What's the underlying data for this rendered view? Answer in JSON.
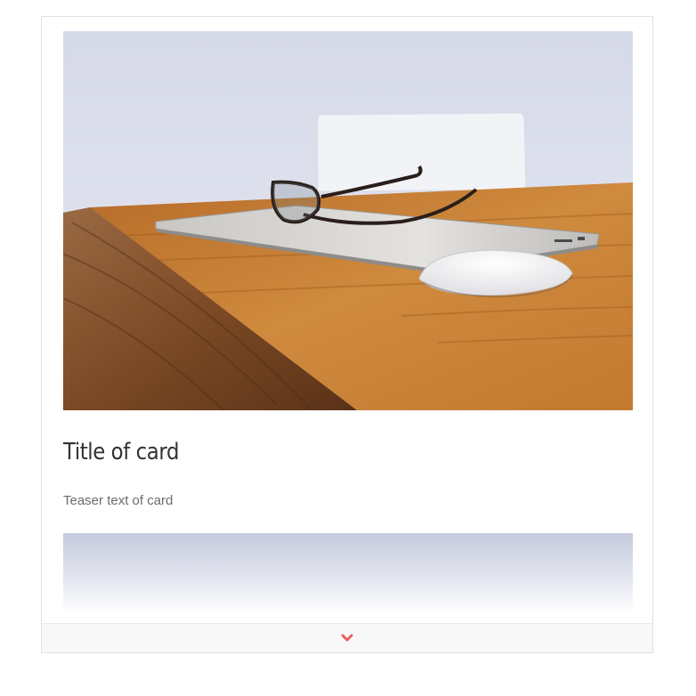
{
  "card": {
    "title": "Title of card",
    "teaser": "Teaser text of card",
    "image_alt": "Laptop, glasses and mouse on a wooden desk"
  },
  "expand_control": {
    "icon": "chevron-down-icon",
    "color": "#e8605a"
  }
}
